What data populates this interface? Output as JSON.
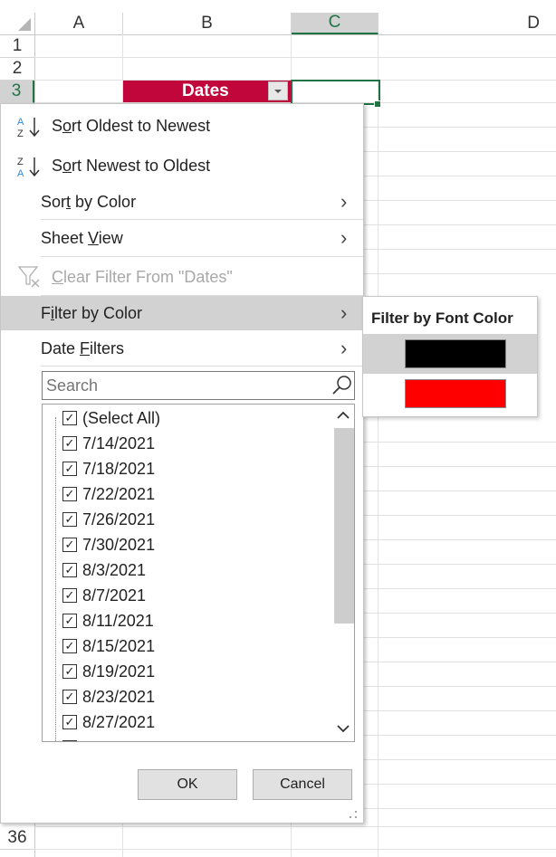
{
  "columns": [
    "A",
    "B",
    "C",
    "D"
  ],
  "rows": [
    "1",
    "2",
    "3",
    "36"
  ],
  "header_cell": {
    "text": "Dates",
    "bg": "#C0063A"
  },
  "menu": {
    "sort_asc": {
      "pre": "S",
      "u": "o",
      "post": "rt Oldest to Newest"
    },
    "sort_desc": {
      "pre": "S",
      "u": "o",
      "post": "rt Newest to Oldest"
    },
    "sort_by_color": {
      "pre": "Sor",
      "u": "t",
      "post": " by Color"
    },
    "sheet_view": {
      "pre": "Sheet ",
      "u": "V",
      "post": "iew"
    },
    "clear_filter": {
      "pre": "",
      "u": "C",
      "post": "lear Filter From \"Dates\""
    },
    "filter_by_color": {
      "pre": "F",
      "u": "i",
      "post": "lter by Color"
    },
    "date_filters": {
      "pre": "Date ",
      "u": "F",
      "post": "ilters"
    },
    "search_placeholder": "Search",
    "items": [
      "(Select All)",
      "7/14/2021",
      "7/18/2021",
      "7/22/2021",
      "7/26/2021",
      "7/30/2021",
      "8/3/2021",
      "8/7/2021",
      "8/11/2021",
      "8/15/2021",
      "8/19/2021",
      "8/23/2021",
      "8/27/2021"
    ],
    "ok": "OK",
    "cancel": "Cancel"
  },
  "submenu": {
    "title": "Filter by Font Color",
    "colors": [
      "#000000",
      "#FF0000"
    ]
  },
  "accent": "#217346"
}
